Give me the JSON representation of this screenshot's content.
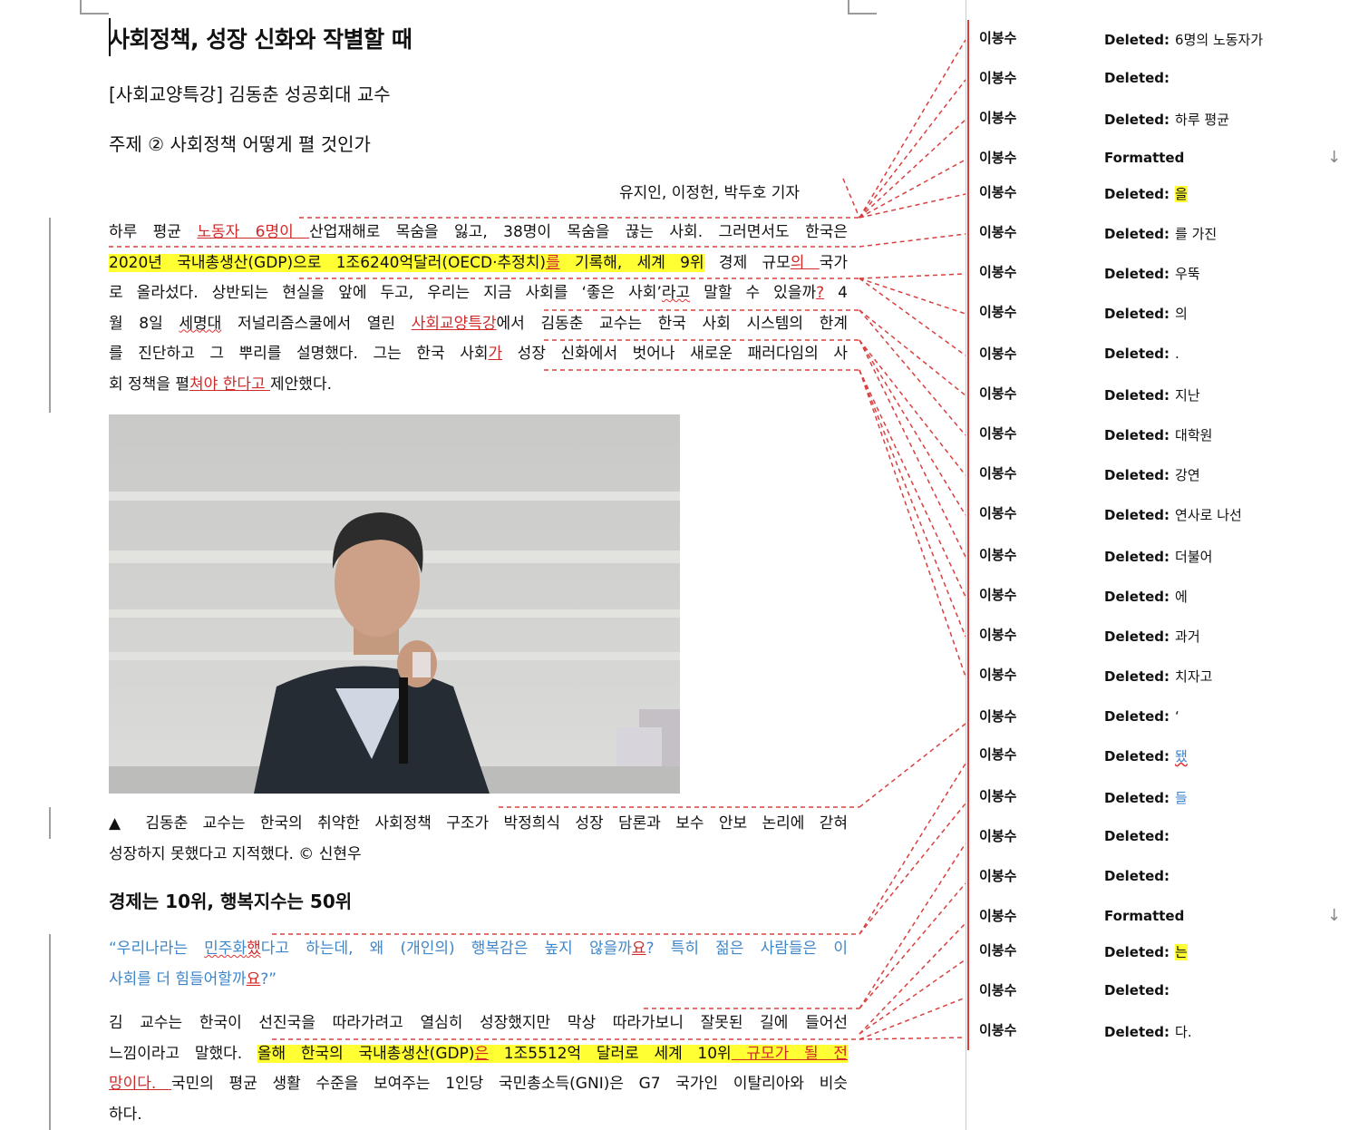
{
  "document": {
    "title": "사회정책, 성장 신화와 작별할 때",
    "subtitle1": "[사회교양특강]  김동춘  성공회대  교수",
    "subtitle2": "주제  ②  사회정책  어떻게  펼  것인가",
    "byline": "유지인,  이정헌,  박두호  기자",
    "para1": {
      "l1a": "하루  평균  ",
      "l1ins": "노동자  6명이 ",
      "l1b": "산업재해로  목숨을  잃고,  38명이  목숨을  끊는  사회.  그러면서도  한국은",
      "l2hl": "2020년  국내총생산(GDP)으로  1조6240억달러(OECD·추정치)",
      "l2ins": "를",
      "l2hl2": "  기록해,  세계  9위",
      "l2b": "  경제  규모",
      "l2ins2": "의 ",
      "l2c": " 국가",
      "l3a": "로  올라섰다.  상반되는  현실을  앞에  두고,  우리는  지금  사회를  ‘좋은  사회’",
      "l3sq": "라고",
      "l3b": "  말할  수  있을까",
      "l3ins": "?",
      "l3c": "  4",
      "l4a": "월  8일  ",
      "l4sq": "세명대",
      "l4b": "  저널리즘스쿨에서  열린  ",
      "l4ins": "사회교양특강",
      "l4c": "에서  김동춘  교수는  한국  사회  시스템의  한계",
      "l5a": "를  진단하고  그  뿌리를  설명했다.  그는  한국  사회",
      "l5ins": "가",
      "l5b": "  성장  신화에서  벗어나  새로운  패러다임의  사",
      "l6a": "회  정책을  펼",
      "l6ins": "쳐야  한다고 ",
      "l6b": " 제안했다."
    },
    "caption": {
      "l1": "▲  김동춘  교수는  한국의  취약한  사회정책  구조가  박정희식  성장  담론과  보수  안보  논리에  갇혀",
      "l2": "성장하지  못했다고  지적했다.  ©  신현우"
    },
    "section_heading": "경제는  10위,  행복지수는  50위",
    "quote": {
      "l1a": "“우리나라는  ",
      "l1sq": "민주화",
      "l1ins": "했",
      "l1b": "다고  하는데,  왜  (개인의)  행복감은  높지  않을까",
      "l1ins2": "요",
      "l1c": "?  특히  젊은  사람들은  이",
      "l2a": "사회를  더  힘들어할까",
      "l2ins": "요",
      "l2b": "?”"
    },
    "para2": {
      "l1": "김  교수는  한국이  선진국을  따라가려고  열심히  성장했지만  막상  따라가보니  잘못된  길에  들어선",
      "l2a": "느낌이라고  말했다.  ",
      "l2hl": "올해  한국의  국내총생산(GDP)",
      "l2ins": "은",
      "l2hl2": "  1조5512억  달러로  세계  10위",
      "l2ins2": "  규모가  될  전",
      "l3ins": "망이다. ",
      "l3b": "  국민의  평균  생활  수준을  보여주는  1인당  국민총소득(GNI)은  G7  국가인  이탈리아와  비슷",
      "l4": "하다."
    }
  },
  "comments": [
    {
      "author": "이봉수",
      "kind": "Deleted:",
      "text": "6명의  노동자가"
    },
    {
      "author": "이봉수",
      "kind": "Deleted:",
      "text": ""
    },
    {
      "author": "이봉수",
      "kind": "Deleted:",
      "text": "하루  평균"
    },
    {
      "author": "이봉수",
      "kind": "Formatted",
      "text": ""
    },
    {
      "author": "이봉수",
      "kind": "Deleted:",
      "text": "을"
    },
    {
      "author": "이봉수",
      "kind": "Deleted:",
      "text": "를  가진"
    },
    {
      "author": "이봉수",
      "kind": "Deleted:",
      "text": "우뚝"
    },
    {
      "author": "이봉수",
      "kind": "Deleted:",
      "text": "의"
    },
    {
      "author": "이봉수",
      "kind": "Deleted:",
      "text": "."
    },
    {
      "author": "이봉수",
      "kind": "Deleted:",
      "text": "지난"
    },
    {
      "author": "이봉수",
      "kind": "Deleted:",
      "text": "대학원"
    },
    {
      "author": "이봉수",
      "kind": "Deleted:",
      "text": "강연"
    },
    {
      "author": "이봉수",
      "kind": "Deleted:",
      "text": "연사로  나선"
    },
    {
      "author": "이봉수",
      "kind": "Deleted:",
      "text": "더불어"
    },
    {
      "author": "이봉수",
      "kind": "Deleted:",
      "text": "에"
    },
    {
      "author": "이봉수",
      "kind": "Deleted:",
      "text": "과거"
    },
    {
      "author": "이봉수",
      "kind": "Deleted:",
      "text": "치자고"
    },
    {
      "author": "이봉수",
      "kind": "Deleted:",
      "text": "‘"
    },
    {
      "author": "이봉수",
      "kind": "Deleted:",
      "text": "됐"
    },
    {
      "author": "이봉수",
      "kind": "Deleted:",
      "text": "들"
    },
    {
      "author": "이봉수",
      "kind": "Deleted:",
      "text": ""
    },
    {
      "author": "이봉수",
      "kind": "Deleted:",
      "text": ""
    },
    {
      "author": "이봉수",
      "kind": "Formatted",
      "text": ""
    },
    {
      "author": "이봉수",
      "kind": "Deleted:",
      "text": "는"
    },
    {
      "author": "이봉수",
      "kind": "Deleted:",
      "text": " "
    },
    {
      "author": "이봉수",
      "kind": "Deleted:",
      "text": "다."
    }
  ],
  "colors": {
    "insertion": "#d02a2a",
    "highlight": "#ffff33",
    "quote": "#3f86c8",
    "leader": "#d8403f"
  },
  "icons": {
    "formatted_marker": "arrow-down-icon"
  }
}
